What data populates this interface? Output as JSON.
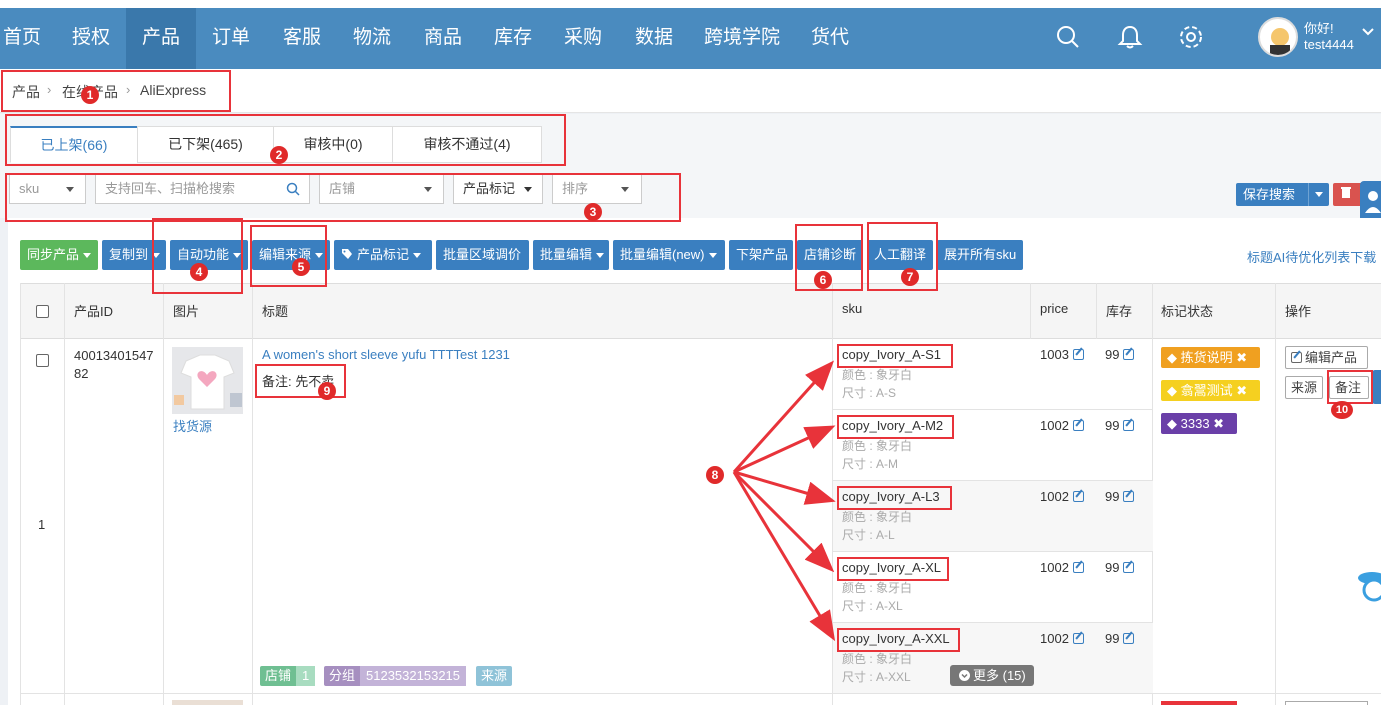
{
  "nav": {
    "items": [
      "首页",
      "授权",
      "产品",
      "订单",
      "客服",
      "物流",
      "商品",
      "库存",
      "采购",
      "数据",
      "跨境学院",
      "货代"
    ],
    "active_index": 2,
    "user_greeting": "你好!",
    "username": "test4444",
    "icons": [
      "search-icon",
      "bell-icon",
      "gear-icon"
    ]
  },
  "breadcrumb": {
    "items": [
      "产品",
      "在线产品",
      "AliExpress"
    ]
  },
  "tabs": [
    "已上架(66)",
    "已下架(465)",
    "审核中(0)",
    "审核不通过(4)"
  ],
  "filters": {
    "sku_select": "sku",
    "search_placeholder": "支持回车、扫描枪搜索",
    "store_select": "店铺",
    "mark_dropdown": "产品标记",
    "sort_select": "排序",
    "save_search": "保存搜索"
  },
  "toolbar": {
    "buttons": [
      "同步产品",
      "复制到",
      "自动功能",
      "编辑来源",
      "产品标记",
      "批量区域调价",
      "批量编辑",
      "批量编辑(new)",
      "下架产品",
      "店铺诊断",
      "人工翻译",
      "展开所有sku"
    ],
    "ai_link": "标题AI待优化列表下载"
  },
  "table": {
    "headers": [
      "产品ID",
      "图片",
      "标题",
      "sku",
      "price",
      "库存",
      "标记状态",
      "操作"
    ]
  },
  "product": {
    "row_number": "1",
    "id": "4001340154782",
    "find_source": "找货源",
    "title": "A women's short sleeve yufu TTTTest 1231",
    "remark": "备注: 先不卖",
    "labels": [
      {
        "name": "店铺",
        "value": "1",
        "color": "#6fbf92"
      },
      {
        "name": "分组",
        "value": "5123532153215",
        "color": "#a68fc0"
      },
      {
        "name": "来源",
        "value": "",
        "color": "#8fc3d8"
      }
    ],
    "skus": [
      {
        "code": "copy_Ivory_A-S1",
        "color": "颜色 : 象牙白",
        "size": "尺寸 : A-S",
        "price": "1003",
        "stock": "99"
      },
      {
        "code": "copy_Ivory_A-M2",
        "color": "颜色 : 象牙白",
        "size": "尺寸 : A-M",
        "price": "1002",
        "stock": "99"
      },
      {
        "code": "copy_Ivory_A-L3",
        "color": "颜色 : 象牙白",
        "size": "尺寸 : A-L",
        "price": "1002",
        "stock": "99"
      },
      {
        "code": "copy_Ivory_A-XL",
        "color": "颜色 : 象牙白",
        "size": "尺寸 : A-XL",
        "price": "1002",
        "stock": "99"
      },
      {
        "code": "copy_Ivory_A-XXL",
        "color": "颜色 : 象牙白",
        "size": "尺寸 : A-XXL",
        "price": "1002",
        "stock": "99"
      }
    ],
    "more_label": "更多 (15)",
    "tags": [
      {
        "text": "拣货说明",
        "color": "#f0a020"
      },
      {
        "text": "翕翯测试",
        "color": "#f5d020"
      },
      {
        "text": "3333",
        "color": "#6a3fa8"
      }
    ],
    "ops": [
      "编辑产品",
      "来源",
      "备注"
    ]
  },
  "annotations": [
    "1",
    "2",
    "3",
    "4",
    "5",
    "6",
    "7",
    "8",
    "9",
    "10"
  ]
}
